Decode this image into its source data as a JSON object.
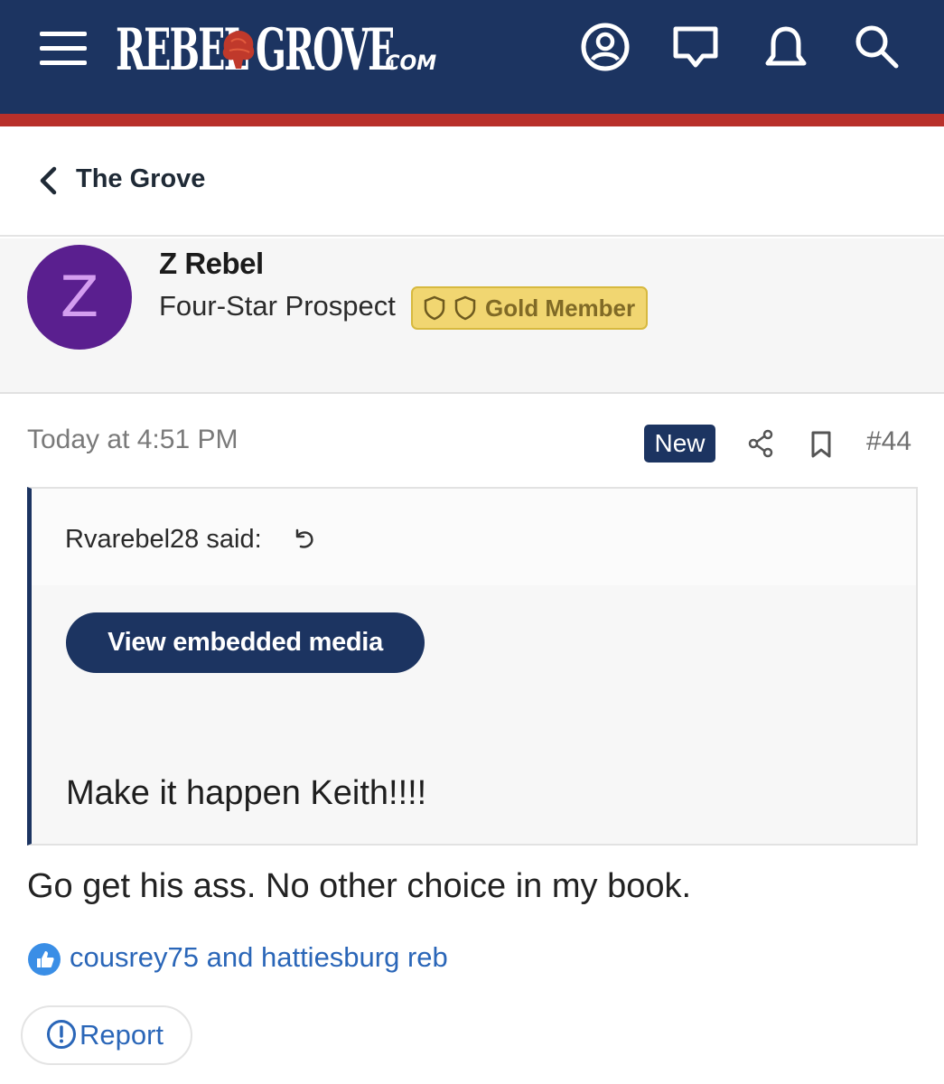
{
  "header": {
    "logo_word_left": "REBEL",
    "logo_word_right": "GROVE",
    "logo_com": ".COM",
    "icons": [
      "menu-icon",
      "account-icon",
      "messages-icon",
      "alerts-icon",
      "search-icon"
    ],
    "brand_color": "#1c3461",
    "accent_color": "#b8302a"
  },
  "nav": {
    "back_label": "The Grove"
  },
  "post": {
    "author": {
      "avatar_letter": "Z",
      "name": "Z Rebel",
      "title": "Four-Star Prospect",
      "badge": "Gold Member"
    },
    "timestamp": "Today at 4:51 PM",
    "new_label": "New",
    "post_number": "#44",
    "quote": {
      "author_label": "Rvarebel28 said:",
      "embed_button": "View embedded media",
      "text": "Make it happen Keith!!!!"
    },
    "body": "Go get his ass. No other choice in my book.",
    "reactions": {
      "likers": "cousrey75 and hattiesburg reb"
    },
    "report_label": "Report"
  }
}
